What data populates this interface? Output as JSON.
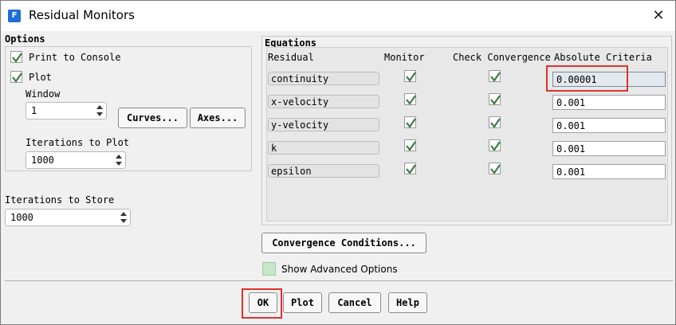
{
  "window": {
    "title": "Residual Monitors",
    "app_icon_letter": "F",
    "close_glyph": "✕"
  },
  "options": {
    "label": "Options",
    "print_to_console": {
      "label": "Print to Console",
      "checked": true
    },
    "plot": {
      "label": "Plot",
      "checked": true
    },
    "window_label": "Window",
    "window_value": "1",
    "curves_button": "Curves...",
    "axes_button": "Axes...",
    "iterations_to_plot_label": "Iterations to Plot",
    "iterations_to_plot_value": "1000"
  },
  "iterations_to_store": {
    "label": "Iterations to Store",
    "value": "1000"
  },
  "equations": {
    "label": "Equations",
    "columns": {
      "residual": "Residual",
      "monitor": "Monitor",
      "check": "Check Convergence",
      "criteria": "Absolute Criteria"
    },
    "rows": [
      {
        "name": "continuity",
        "monitor": true,
        "check": true,
        "criteria": "0.00001"
      },
      {
        "name": "x-velocity",
        "monitor": true,
        "check": true,
        "criteria": "0.001"
      },
      {
        "name": "y-velocity",
        "monitor": true,
        "check": true,
        "criteria": "0.001"
      },
      {
        "name": "k",
        "monitor": true,
        "check": true,
        "criteria": "0.001"
      },
      {
        "name": "epsilon",
        "monitor": true,
        "check": true,
        "criteria": "0.001"
      }
    ]
  },
  "convergence_conditions_button": "Convergence Conditions...",
  "show_advanced_options": {
    "label": "Show Advanced Options",
    "checked": false
  },
  "footer": {
    "ok": "OK",
    "plot": "Plot",
    "cancel": "Cancel",
    "help": "Help"
  },
  "colors": {
    "check_green": "#3f7a45",
    "highlight_red": "#e0322c",
    "advanced_box": "#c8e6c9"
  }
}
